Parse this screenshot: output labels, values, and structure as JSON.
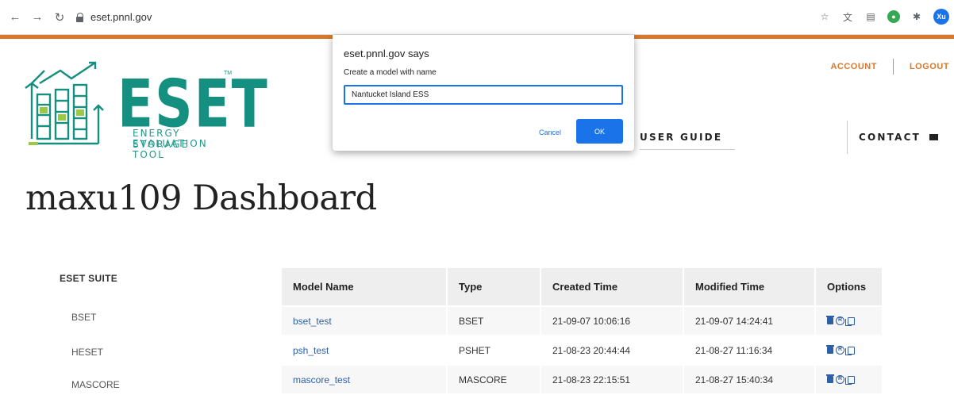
{
  "browser": {
    "url": "eset.pnnl.gov",
    "avatar_initials": "Xu",
    "extensions": [
      "star-icon",
      "translate-icon",
      "reader-icon",
      "green-extension-icon",
      "puzzle-icon"
    ]
  },
  "header": {
    "logo_text": "ESET",
    "logo_tm": "TM",
    "logo_subtitle_line1": "ENERGY STORAGE",
    "logo_subtitle_line2": "EVALUATION TOOL",
    "account_label": "ACCOUNT",
    "logout_label": "LOGOUT",
    "nav": {
      "user_guide": "USER GUIDE",
      "contact": "CONTACT"
    }
  },
  "dialog": {
    "title": "eset.pnnl.gov says",
    "message": "Create a model with name",
    "input_value": "Nantucket Island ESS",
    "cancel_label": "Cancel",
    "ok_label": "OK"
  },
  "dashboard": {
    "title": "maxu109 Dashboard",
    "suite": {
      "heading": "ESET SUITE",
      "items": [
        "BSET",
        "HESET",
        "MASCORE"
      ]
    },
    "table": {
      "headers": [
        "Model Name",
        "Type",
        "Created Time",
        "Modified Time",
        "Options"
      ],
      "rows": [
        {
          "name": "bset_test",
          "type": "BSET",
          "created": "21-09-07 10:06:16",
          "modified": "21-09-07 14:24:41"
        },
        {
          "name": "psh_test",
          "type": "PSHET",
          "created": "21-08-23 20:44:44",
          "modified": "21-08-27 11:16:34"
        },
        {
          "name": "mascore_test",
          "type": "MASCORE",
          "created": "21-08-23 22:15:51",
          "modified": "21-08-27 15:40:34"
        }
      ],
      "option_icons": [
        "trash-icon",
        "registered-icon",
        "copy-icon"
      ]
    }
  },
  "colors": {
    "brand_teal": "#148f80",
    "accent_orange": "#d9782b",
    "link_blue": "#2d5fa6",
    "dialog_blue": "#1a73e8"
  }
}
